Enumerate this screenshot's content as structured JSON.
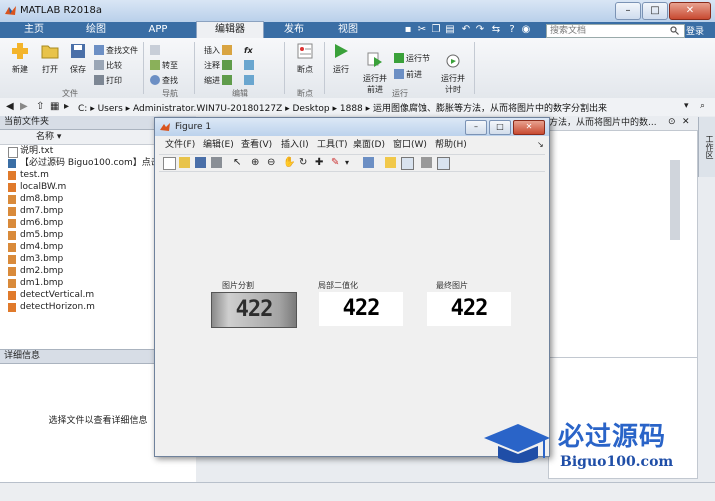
{
  "window": {
    "title": "MATLAB R2018a",
    "min": "–",
    "max": "□",
    "close": "✕"
  },
  "tabs": [
    "主页",
    "绘图",
    "APP",
    "编辑器",
    "发布",
    "视图"
  ],
  "search": {
    "placeholder": "搜索文档"
  },
  "user": "登录",
  "ribbon": {
    "file": {
      "new": "新建",
      "open": "打开",
      "save": "保存",
      "find_files": "查找文件",
      "compare": "比较",
      "print": "打印",
      "group": "文件"
    },
    "nav": {
      "goto": "转至",
      "find": "查找",
      "group": "导航"
    },
    "edit": {
      "insert": "插入",
      "comment": "注释",
      "indent": "缩进",
      "fx": "fx",
      "group": "编辑"
    },
    "breakpoints": {
      "label": "断点",
      "group": "断点"
    },
    "run": {
      "run": "运行",
      "run_advance": "运行并\n前进",
      "run_section": "运行节",
      "advance": "前进",
      "run_time": "运行并\n计时",
      "group": "运行"
    }
  },
  "address": {
    "path": [
      "C:",
      "Users",
      "Administrator.WIN7U-20180127Z",
      "Desktop",
      "1888",
      "运用图像腐蚀、膨胀等方法，从而将图片中的数字分割出来"
    ]
  },
  "left_panel": {
    "title": "当前文件夹",
    "column": "名称 ▾",
    "files": [
      {
        "name": "说明.txt",
        "type": "txt"
      },
      {
        "name": "【必过源码 Biguo100.com】点击",
        "type": "link"
      },
      {
        "name": "test.m",
        "type": "m"
      },
      {
        "name": "localBW.m",
        "type": "m"
      },
      {
        "name": "dm8.bmp",
        "type": "bmp"
      },
      {
        "name": "dm7.bmp",
        "type": "bmp"
      },
      {
        "name": "dm6.bmp",
        "type": "bmp"
      },
      {
        "name": "dm5.bmp",
        "type": "bmp"
      },
      {
        "name": "dm4.bmp",
        "type": "bmp"
      },
      {
        "name": "dm3.bmp",
        "type": "bmp"
      },
      {
        "name": "dm2.bmp",
        "type": "bmp"
      },
      {
        "name": "dm1.bmp",
        "type": "bmp"
      },
      {
        "name": "detectVertical.m",
        "type": "m"
      },
      {
        "name": "detectHorizon.m",
        "type": "m"
      }
    ],
    "detail_title": "详细信息",
    "detail_msg": "选择文件以查看详细信息"
  },
  "right": {
    "cmd_title": "等方法，从而将图片中的数...",
    "workspace": "工作区"
  },
  "figure": {
    "title": "Figure 1",
    "menu": [
      "文件(F)",
      "编辑(E)",
      "查看(V)",
      "插入(I)",
      "工具(T)",
      "桌面(D)",
      "窗口(W)",
      "帮助(H)"
    ],
    "subplots": [
      {
        "title": "图片分割",
        "digits": "422"
      },
      {
        "title": "局部二值化",
        "digits": "422"
      },
      {
        "title": "最终图片",
        "digits": "422"
      }
    ]
  },
  "watermark": {
    "cn": "必过源码",
    "url": "Biguo100.com"
  },
  "colors": {
    "titlebar": "#c9dbef",
    "tabstrip": "#3a6ea5",
    "accent": "#2a64c8"
  }
}
